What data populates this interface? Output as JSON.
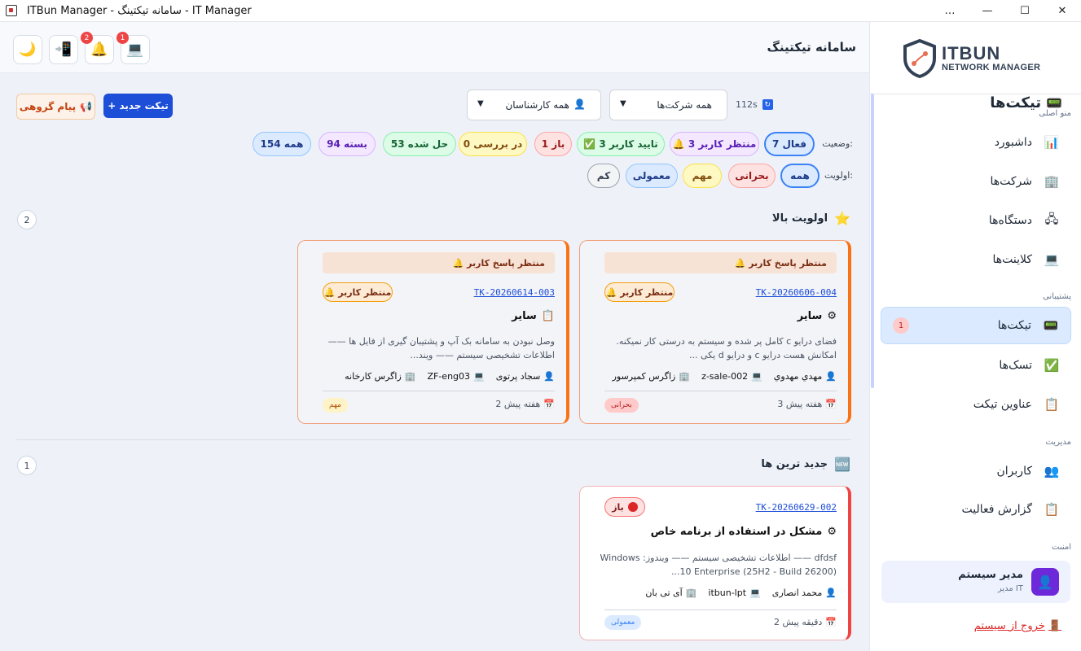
{
  "window": {
    "title": "ITBun Manager - سامانه تیکتینگ - IT Manager",
    "controls": [
      "…",
      "—",
      "☐",
      "✕"
    ]
  },
  "brand": {
    "line1": "ITBUN",
    "line2": "NETWORK MANAGER"
  },
  "sidebar": {
    "sections": [
      "منو اصلی",
      "پشتیبانی",
      "مدیریت",
      "امنیت"
    ],
    "items": [
      {
        "label": "داشبورد",
        "icon": "chart-icon",
        "glyph": "📊"
      },
      {
        "label": "شرکت‌ها",
        "icon": "building-icon",
        "glyph": "🏢"
      },
      {
        "label": "دستگاه‌ها",
        "icon": "network-icon",
        "glyph": "🖧"
      },
      {
        "label": "کلاینت‌ها",
        "icon": "laptop-icon",
        "glyph": "💻"
      },
      {
        "label": "تیکت‌ها",
        "icon": "ticket-icon",
        "glyph": "📟",
        "badge": "1"
      },
      {
        "label": "تسک‌ها",
        "icon": "check-icon",
        "glyph": "✅"
      },
      {
        "label": "عناوین تیکت",
        "icon": "clipboard-icon",
        "glyph": "📋"
      },
      {
        "label": "کاربران",
        "icon": "users-icon",
        "glyph": "👥"
      },
      {
        "label": "گزارش فعالیت",
        "icon": "report-icon",
        "glyph": "📋"
      }
    ],
    "user": {
      "name": "مدير سيستم",
      "role": "مدير IT"
    },
    "logout": "خروج از سیستم"
  },
  "header": {
    "title": "سامانه تیکتینگ",
    "buttons": [
      {
        "name": "client-button",
        "glyph": "💻",
        "badge": "1"
      },
      {
        "name": "notifications-button",
        "glyph": "🔔",
        "badge": "2"
      },
      {
        "name": "mobile-button",
        "glyph": "📲",
        "badge": ""
      },
      {
        "name": "theme-button",
        "glyph": "🌙",
        "badge": ""
      }
    ]
  },
  "tickets": {
    "title": "تیکت‌ها",
    "refresh": "112s",
    "company_filter": "همه شرکت‌ها",
    "expert_filter": "همه کارشناسان",
    "new_button": "+ تیکت جدید",
    "group_button": "پیام گروهی",
    "status_label": "وضعیت:",
    "priority_label": "اولویت:",
    "status_chips": [
      {
        "label": "فعال 7",
        "bg": "#dbeafe",
        "border": "#3b82f6",
        "color": "#1e3a8a"
      },
      {
        "label": "🔔 منتظر کاربر 3",
        "bg": "#f3e8ff",
        "border": "#d8b4fe",
        "color": "#5b21b6"
      },
      {
        "label": "✅ تایید کاربر 3",
        "bg": "#dcfce7",
        "border": "#86efac",
        "color": "#166534"
      },
      {
        "label": "باز 1",
        "bg": "#fee2e2",
        "border": "#fca5a5",
        "color": "#991b1b"
      },
      {
        "label": "در بررسی 0",
        "bg": "#fef9c3",
        "border": "#fde047",
        "color": "#854d0e"
      },
      {
        "label": "حل شده 53",
        "bg": "#dcfce7",
        "border": "#86efac",
        "color": "#166534"
      },
      {
        "label": "بسته 94",
        "bg": "#f3e8ff",
        "border": "#d8b4fe",
        "color": "#5b21b6"
      },
      {
        "label": "همه 154",
        "bg": "#dbeafe",
        "border": "#93c5fd",
        "color": "#1e3a8a"
      }
    ],
    "priority_chips": [
      {
        "label": "همه",
        "bg": "#dbeafe",
        "border": "#3b82f6",
        "color": "#1e3a8a"
      },
      {
        "label": "بحرانی",
        "bg": "#fee2e2",
        "border": "#fca5a5",
        "color": "#991b1b"
      },
      {
        "label": "مهم",
        "bg": "#fef9c3",
        "border": "#fde047",
        "color": "#854d0e"
      },
      {
        "label": "معمولی",
        "bg": "#dbeafe",
        "border": "#93c5fd",
        "color": "#1e3a8a"
      },
      {
        "label": "کم",
        "bg": "#f3f4f6",
        "border": "#9ca3af",
        "color": "#374151"
      }
    ]
  },
  "sections": {
    "high": {
      "title": "اولویت بالا",
      "count": "2"
    },
    "newest": {
      "title": "جدید ترین ها",
      "count": "1"
    }
  },
  "cards": [
    {
      "banner": "🔔 منتظر پاسخ کاربر",
      "id": "TK-20260606-004",
      "status": "🔔 منتظر کاربر",
      "title": "سایر",
      "title_glyph": "⚙",
      "desc": "فضای درایو c کامل پر شده و سیستم به درستی کار نمیکنه. امکانش هست درایو c و درایو d یکی ...",
      "user": "مهدي مهدوي",
      "device": "z-sale-002",
      "company": "زاگرس کمپرسور",
      "time": "3 هفته پیش",
      "priority": "بحرانی"
    },
    {
      "banner": "🔔 منتظر پاسخ کاربر",
      "id": "TK-20260614-003",
      "status": "🔔 منتظر کاربر",
      "title": "سایر",
      "title_glyph": "📋",
      "desc": "وصل نبودن به سامانه بک آپ و پشتیبان گیری از فایل ها —— اطلاعات تشخیصی سیستم —— ویند...",
      "user": "سجاد پرتوی",
      "device": "ZF-eng03",
      "company": "زاگرس کارخانه",
      "time": "2 هفته پیش",
      "priority": "مهم"
    },
    {
      "id": "TK-20260629-002",
      "status": "باز",
      "title": "مشکل در استفاده از برنامه خاص",
      "title_glyph": "⚙",
      "desc": "dfdsf —— اطلاعات تشخیصی سیستم —— ویندوز: Windows 10 Enterprise (25H2 - Build 26200)...",
      "user": "محمد انصاری",
      "device": "itbun-lpt",
      "company": "آی تی بان",
      "time": "2 دقیقه پیش",
      "priority": "معمولی"
    }
  ]
}
